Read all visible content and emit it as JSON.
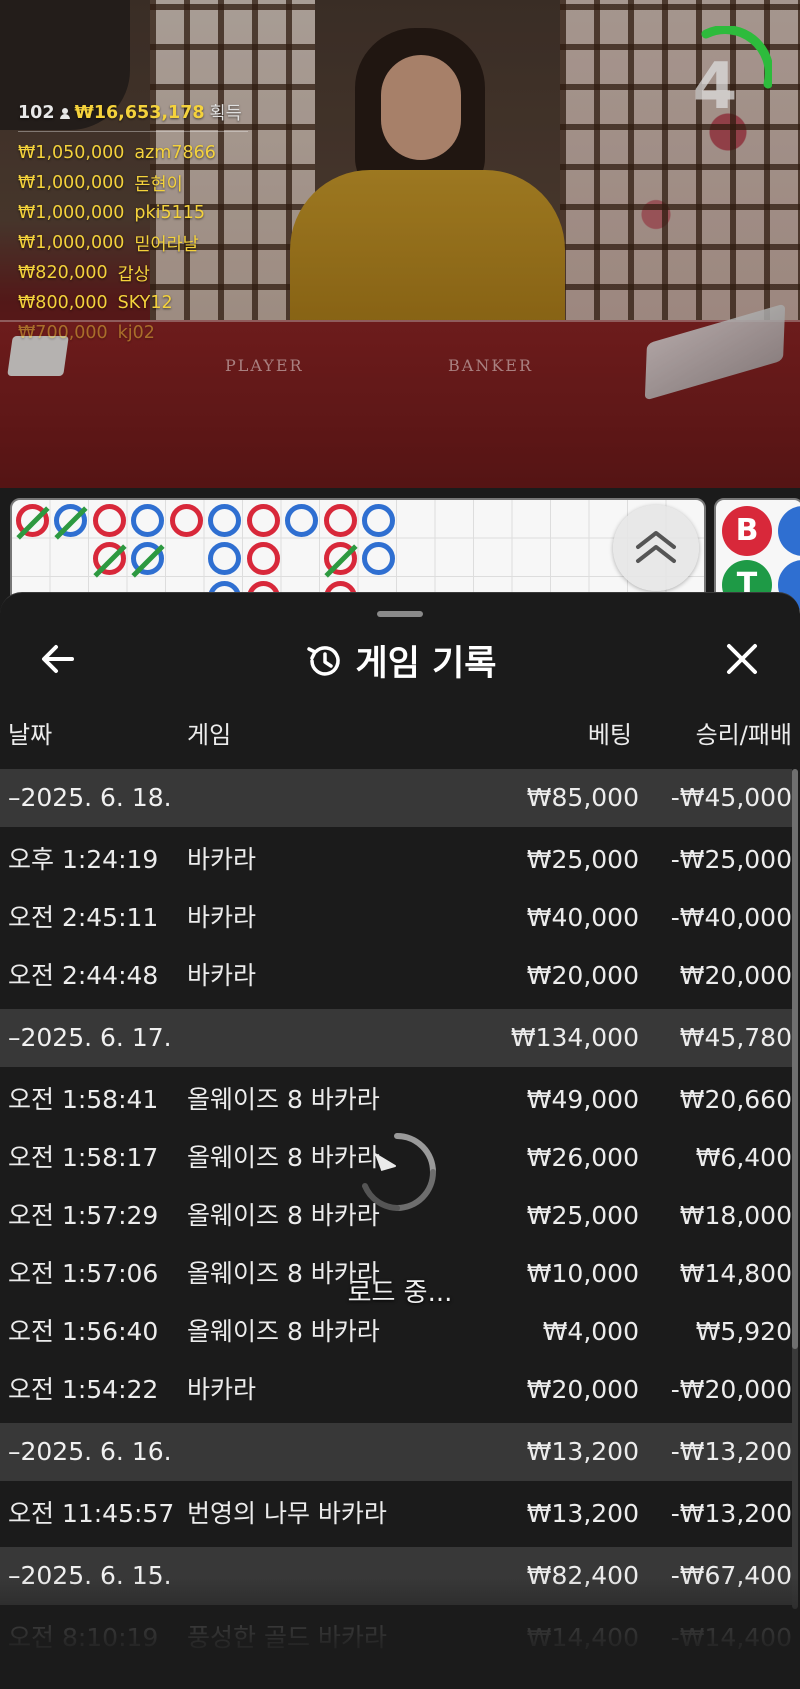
{
  "stream": {
    "felt_player": "PLAYER",
    "felt_banker": "BANKER",
    "timer": "4",
    "winners_header": {
      "count": "102",
      "total": "₩16,653,178",
      "label": "획득"
    },
    "winners": [
      {
        "amount": "₩1,050,000",
        "name": "azm7866"
      },
      {
        "amount": "₩1,000,000",
        "name": "돈현이"
      },
      {
        "amount": "₩1,000,000",
        "name": "pki5115"
      },
      {
        "amount": "₩1,000,000",
        "name": "믿어라날"
      },
      {
        "amount": "₩820,000",
        "name": "갑상"
      },
      {
        "amount": "₩800,000",
        "name": "SKY12"
      },
      {
        "amount": "₩700,000",
        "name": "kj02"
      }
    ]
  },
  "roadmap": {
    "side_badges": {
      "banker": "B",
      "tie": "T"
    }
  },
  "sheet": {
    "title": "게임 기록",
    "columns": {
      "date": "날짜",
      "game": "게임",
      "bet": "베팅",
      "win_loss": "승리/패배"
    },
    "rows": [
      {
        "type": "group",
        "date": "–2025. 6. 18.",
        "game": "",
        "bet": "₩85,000",
        "win_loss": "-₩45,000"
      },
      {
        "type": "item",
        "date": "오후 1:24:19",
        "game": "바카라",
        "bet": "₩25,000",
        "win_loss": "-₩25,000"
      },
      {
        "type": "item",
        "date": "오전 2:45:11",
        "game": "바카라",
        "bet": "₩40,000",
        "win_loss": "-₩40,000"
      },
      {
        "type": "item",
        "date": "오전 2:44:48",
        "game": "바카라",
        "bet": "₩20,000",
        "win_loss": "₩20,000"
      },
      {
        "type": "group",
        "date": "–2025. 6. 17.",
        "game": "",
        "bet": "₩134,000",
        "win_loss": "₩45,780"
      },
      {
        "type": "item",
        "date": "오전 1:58:41",
        "game": "올웨이즈 8 바카라",
        "bet": "₩49,000",
        "win_loss": "₩20,660"
      },
      {
        "type": "item",
        "date": "오전 1:58:17",
        "game": "올웨이즈 8 바카라",
        "bet": "₩26,000",
        "win_loss": "₩6,400"
      },
      {
        "type": "item",
        "date": "오전 1:57:29",
        "game": "올웨이즈 8 바카라",
        "bet": "₩25,000",
        "win_loss": "₩18,000"
      },
      {
        "type": "item",
        "date": "오전 1:57:06",
        "game": "올웨이즈 8 바카라",
        "bet": "₩10,000",
        "win_loss": "₩14,800"
      },
      {
        "type": "item",
        "date": "오전 1:56:40",
        "game": "올웨이즈 8 바카라",
        "bet": "₩4,000",
        "win_loss": "₩5,920"
      },
      {
        "type": "item",
        "date": "오전 1:54:22",
        "game": "바카라",
        "bet": "₩20,000",
        "win_loss": "-₩20,000"
      },
      {
        "type": "group",
        "date": "–2025. 6. 16.",
        "game": "",
        "bet": "₩13,200",
        "win_loss": "-₩13,200"
      },
      {
        "type": "item",
        "date": "오전 11:45:57",
        "game": "번영의 나무 바카라",
        "bet": "₩13,200",
        "win_loss": "-₩13,200"
      },
      {
        "type": "group",
        "date": "–2025. 6. 15.",
        "game": "",
        "bet": "₩82,400",
        "win_loss": "-₩67,400"
      },
      {
        "type": "item",
        "date": "오전 8:10:19",
        "game": "풍성한 골드 바카라",
        "bet": "₩14,400",
        "win_loss": "-₩14,400"
      }
    ],
    "loading_text": "로드 중..."
  },
  "colors": {
    "accent_gold": "#f4d23c",
    "banker_red": "#d8283a",
    "player_blue": "#2f6fd1",
    "tie_green": "#1e9a46",
    "sheet_bg": "#1b1b1b",
    "group_row_bg": "#383838"
  },
  "icons": {
    "back": "arrow-left-icon",
    "history": "history-clock-icon",
    "close": "close-icon",
    "expand": "chevron-double-up-icon",
    "spinner": "loading-spinner-icon"
  }
}
